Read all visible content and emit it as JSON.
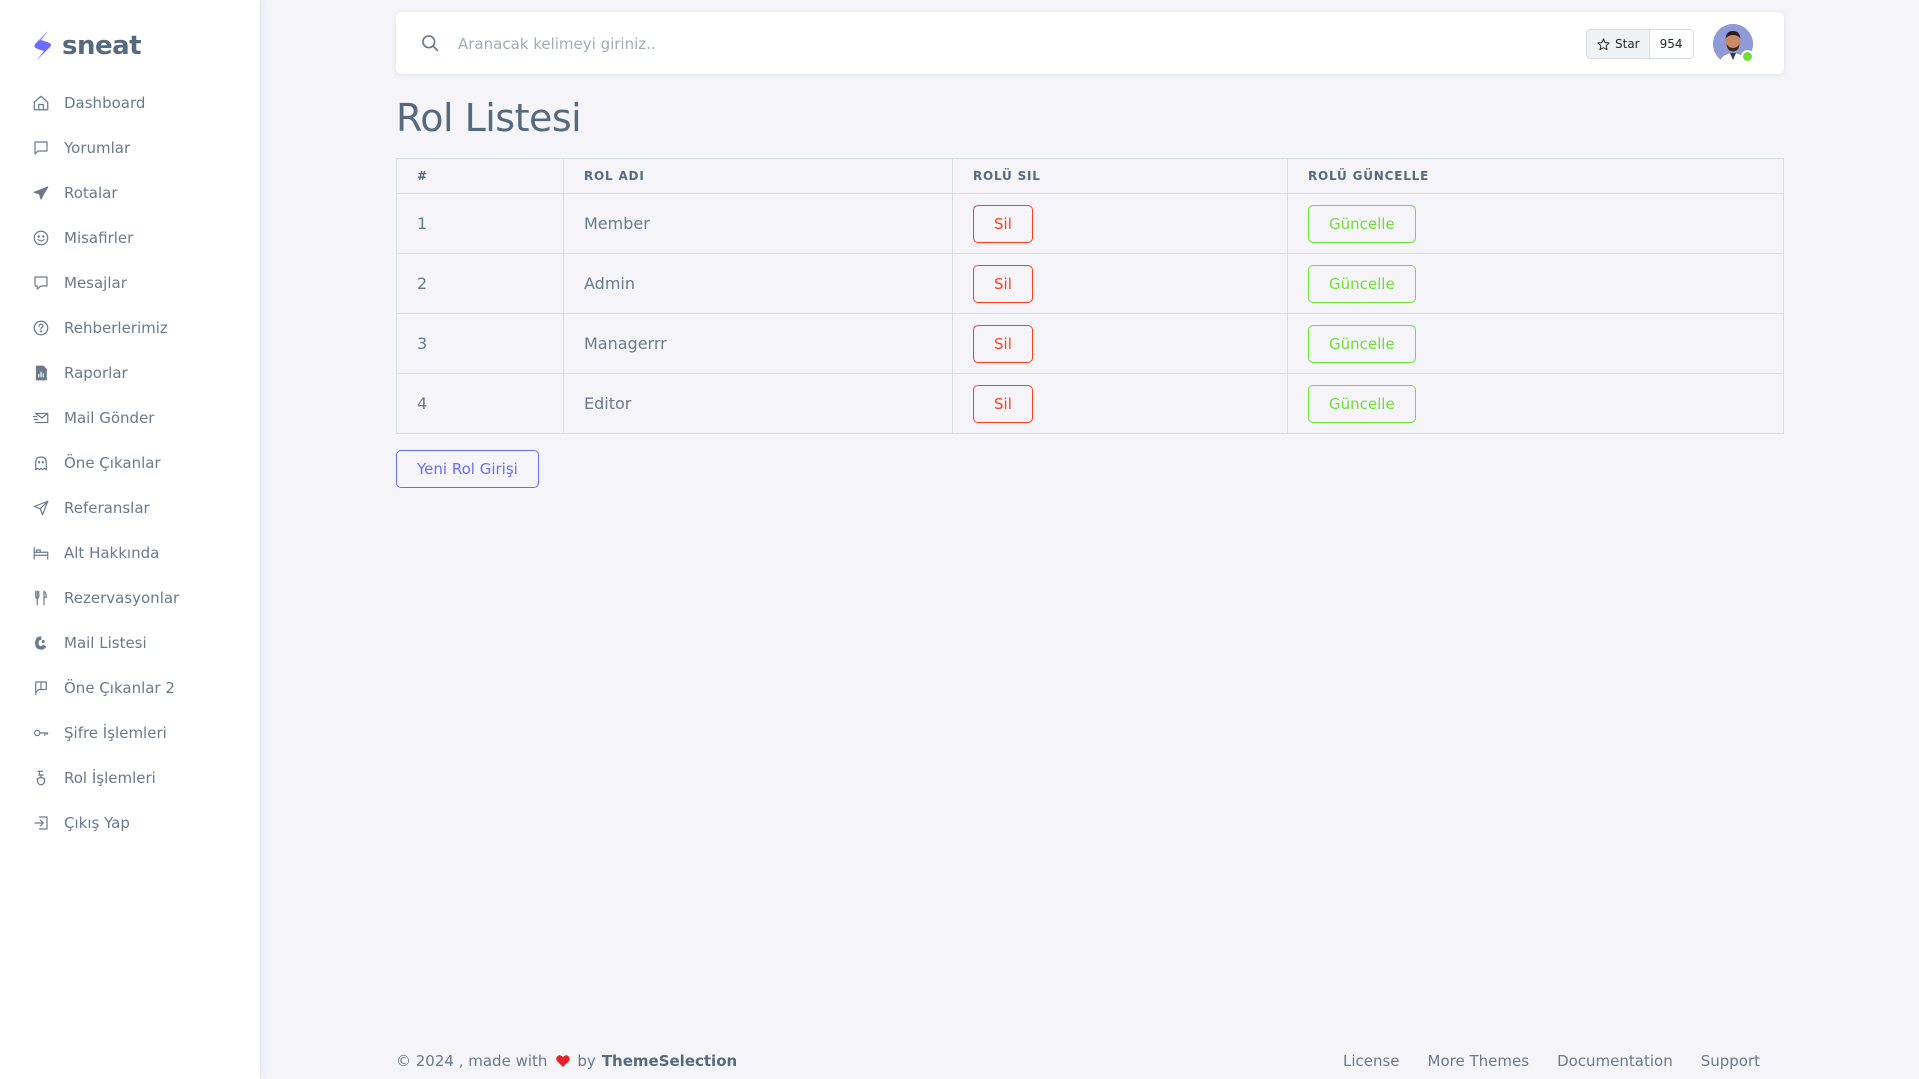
{
  "brand": {
    "name": "sneat"
  },
  "sidebar": {
    "items": [
      {
        "label": "Dashboard",
        "icon": "home-icon"
      },
      {
        "label": "Yorumlar",
        "icon": "comment-icon"
      },
      {
        "label": "Rotalar",
        "icon": "plane-icon"
      },
      {
        "label": "Misafirler",
        "icon": "smile-icon"
      },
      {
        "label": "Mesajlar",
        "icon": "message-icon"
      },
      {
        "label": "Rehberlerimiz",
        "icon": "help-circle-icon"
      },
      {
        "label": "Raporlar",
        "icon": "report-icon"
      },
      {
        "label": "Mail Gönder",
        "icon": "mail-send-icon"
      },
      {
        "label": "Öne Çıkanlar",
        "icon": "ghost-icon"
      },
      {
        "label": "Referanslar",
        "icon": "send-icon"
      },
      {
        "label": "Alt Hakkında",
        "icon": "bed-icon"
      },
      {
        "label": "Rezervasyonlar",
        "icon": "restaurant-icon"
      },
      {
        "label": "Mail Listesi",
        "icon": "mailchimp-icon"
      },
      {
        "label": "Öne Çıkanlar 2",
        "icon": "flag-icon"
      },
      {
        "label": "Şifre İşlemleri",
        "icon": "key-icon"
      },
      {
        "label": "Rol İşlemleri",
        "icon": "mask-icon"
      },
      {
        "label": "Çıkış Yap",
        "icon": "log-out-icon"
      }
    ]
  },
  "navbar": {
    "search_placeholder": "Aranacak kelimeyi giriniz..",
    "star_label": "Star",
    "star_count": "954"
  },
  "page": {
    "title": "Rol Listesi"
  },
  "table": {
    "headers": [
      "#",
      "ROL ADI",
      "ROLÜ SIL",
      "ROLÜ GÜNCELLE"
    ],
    "rows": [
      {
        "id": "1",
        "name": "Member",
        "delete_label": "Sil",
        "update_label": "Güncelle"
      },
      {
        "id": "2",
        "name": "Admin",
        "delete_label": "Sil",
        "update_label": "Güncelle"
      },
      {
        "id": "3",
        "name": "Managerrr",
        "delete_label": "Sil",
        "update_label": "Güncelle"
      },
      {
        "id": "4",
        "name": "Editor",
        "delete_label": "Sil",
        "update_label": "Güncelle"
      }
    ]
  },
  "actions": {
    "new_role_label": "Yeni Rol Girişi"
  },
  "footer": {
    "copyright": "© 2024 , made with",
    "by": "by",
    "brand": "ThemeSelection",
    "links": [
      "License",
      "More Themes",
      "Documentation",
      "Support"
    ]
  },
  "colors": {
    "primary": "#696cff",
    "danger": "#ff3e1d",
    "success": "#71dd37",
    "text": "#697a8d",
    "heading": "#566a7f",
    "background": "#f5f5f9"
  }
}
